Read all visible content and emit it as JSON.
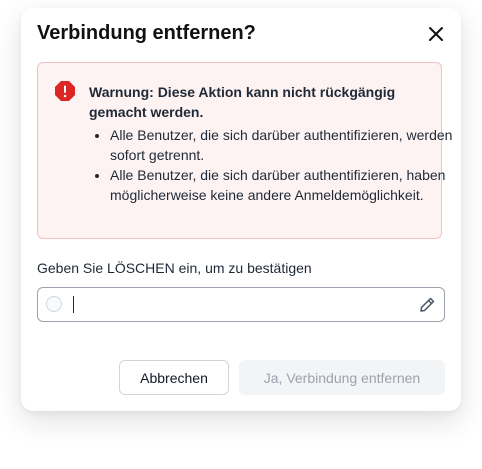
{
  "dialog": {
    "title": "Verbindung entfernen?"
  },
  "warning": {
    "heading": "Warnung: Diese Aktion kann nicht rückgängig gemacht werden.",
    "bullets": [
      "Alle Benutzer, die sich darüber authentifizieren, werden sofort getrennt.",
      "Alle Benutzer, die sich darüber authentifizieren, haben möglicherweise keine andere Anmeldemöglichkeit."
    ]
  },
  "confirm": {
    "label": "Geben Sie LÖSCHEN ein, um zu bestätigen",
    "value": ""
  },
  "buttons": {
    "cancel": "Abbrechen",
    "confirm": "Ja, Verbindung entfernen"
  },
  "colors": {
    "warning_icon": "#dc2626",
    "warning_background": "#fdf3f3",
    "warning_border": "#f3c1c1",
    "disabled_button_text": "#9ca3af"
  },
  "icons": {
    "close": "close-icon",
    "warning": "warning-octagon-icon",
    "input_status": "circle-icon",
    "edit": "pencil-icon"
  }
}
